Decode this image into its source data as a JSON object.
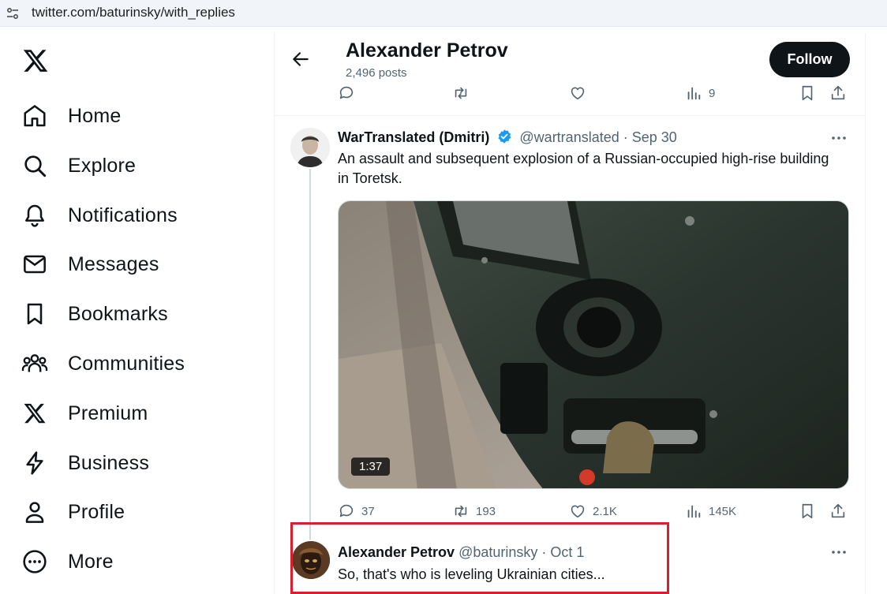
{
  "browser": {
    "url": "twitter.com/baturinsky/with_replies"
  },
  "sidebar": {
    "items": [
      {
        "label": "Home",
        "icon": "home-icon"
      },
      {
        "label": "Explore",
        "icon": "search-icon"
      },
      {
        "label": "Notifications",
        "icon": "bell-icon"
      },
      {
        "label": "Messages",
        "icon": "mail-icon"
      },
      {
        "label": "Bookmarks",
        "icon": "bookmark-icon"
      },
      {
        "label": "Communities",
        "icon": "communities-icon"
      },
      {
        "label": "Premium",
        "icon": "x-logo-icon"
      },
      {
        "label": "Business",
        "icon": "lightning-icon"
      },
      {
        "label": "Profile",
        "icon": "person-icon"
      },
      {
        "label": "More",
        "icon": "more-circle-icon"
      }
    ]
  },
  "header": {
    "title": "Alexander Petrov",
    "subtitle": "2,496 posts",
    "follow_label": "Follow"
  },
  "top_actions": {
    "views": "9"
  },
  "tweet1": {
    "name": "WarTranslated (Dmitri)",
    "handle": "@wartranslated · Sep 30",
    "text": "An assault and subsequent explosion of a Russian-occupied high-rise building in Toretsk.",
    "duration": "1:37",
    "replies": "37",
    "retweets": "193",
    "likes": "2.1K",
    "views": "145K"
  },
  "tweet2": {
    "name": "Alexander Petrov",
    "handle": "@baturinsky · Oct 1",
    "text": "So, that's who is leveling Ukrainian cities..."
  },
  "colors": {
    "verified": "#1d9bf0",
    "highlight": "#d9202a",
    "text_secondary": "#536471"
  }
}
